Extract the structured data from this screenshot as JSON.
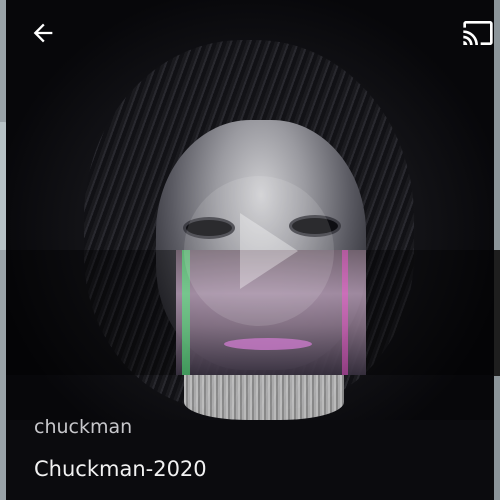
{
  "topbar": {
    "back_icon": "arrow-left-icon",
    "cast_icon": "cast-icon"
  },
  "artwork": {
    "subject": "lion-man glitch portrait",
    "play_icon": "play-icon"
  },
  "track": {
    "author": "chuckman",
    "title": "Chuckman-2020"
  },
  "colors": {
    "background": "#0b0b0e",
    "text_primary": "#f2f2f2",
    "text_secondary": "#c8c8cc",
    "accent_green": "#2c7a2c"
  }
}
